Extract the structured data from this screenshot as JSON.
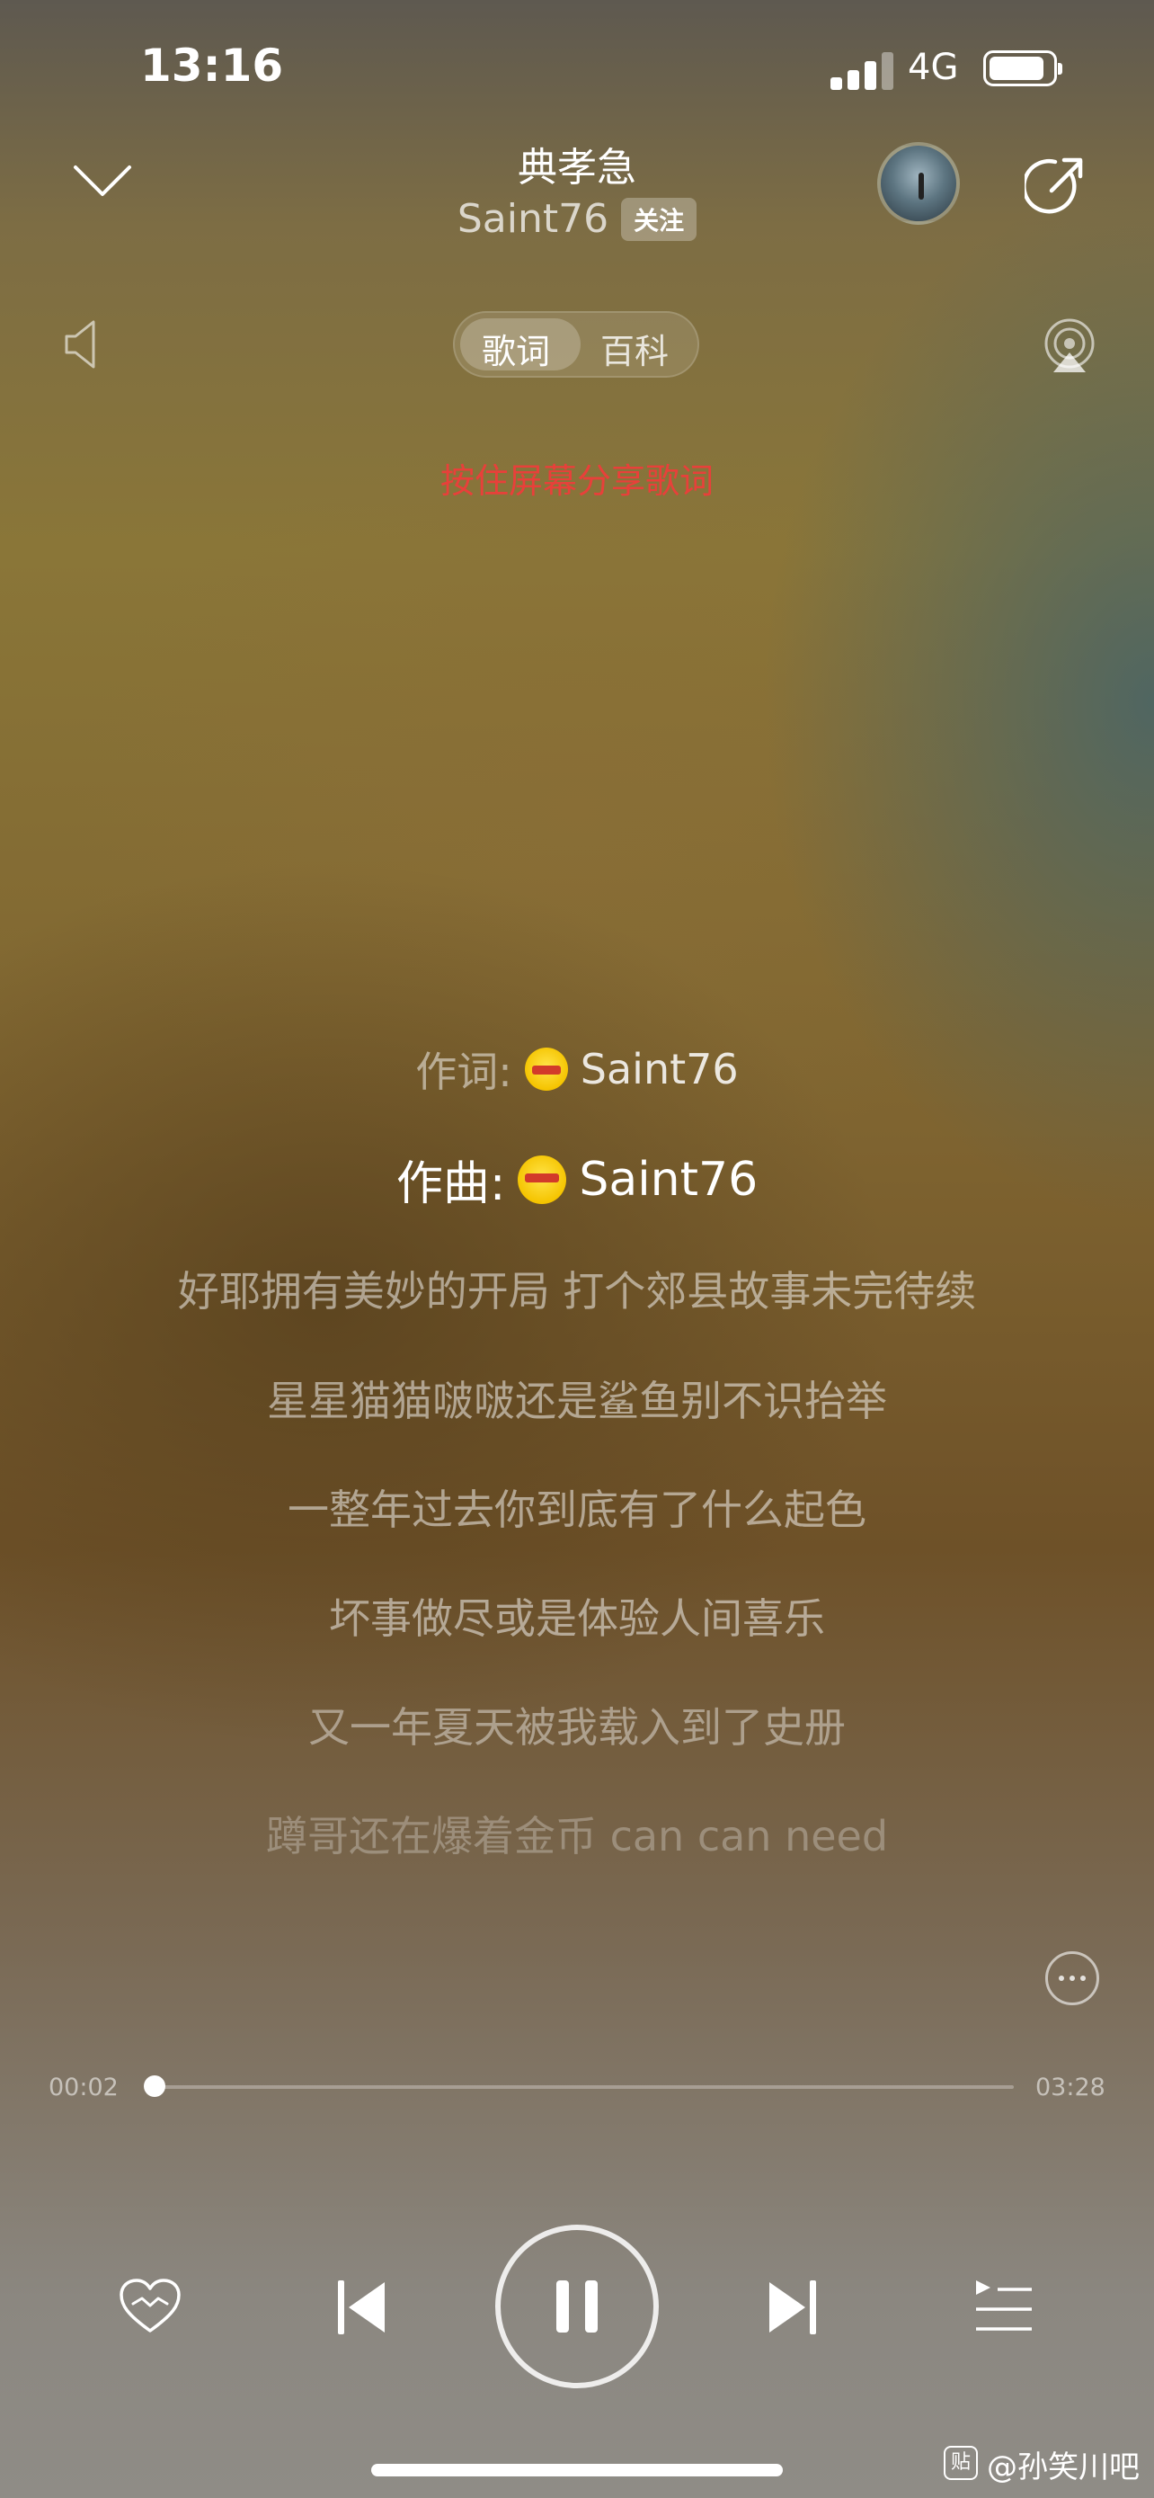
{
  "status_bar": {
    "time": "13:16",
    "network": "4G"
  },
  "header": {
    "title": "典孝急",
    "artist": "Saint76",
    "follow_label": "关注"
  },
  "tabs": [
    {
      "label": "歌词",
      "active": true
    },
    {
      "label": "百科",
      "active": false
    }
  ],
  "share_hint": "按住屏幕分享歌词",
  "lyrics": {
    "lyricist_prefix": "作词:",
    "lyricist": "Saint76",
    "composer_prefix": "作曲:",
    "composer": "Saint76",
    "lines": [
      "好耶拥有美妙的开局 打个郊县故事未完待续",
      "星星猫猫啵啵还是鲨鱼别不识抬举",
      "一整年过去你到底有了什么起色",
      "坏事做尽或是体验人间喜乐",
      "又一年夏天被我载入到了史册",
      "蹲哥还在爆着金币 can can need"
    ]
  },
  "player": {
    "elapsed": "00:02",
    "duration": "03:28",
    "progress_fraction": 0.01
  },
  "watermark": "@孙笑川吧",
  "watermark_icon": "贴",
  "colors": {
    "share_hint": "#e8403a"
  }
}
